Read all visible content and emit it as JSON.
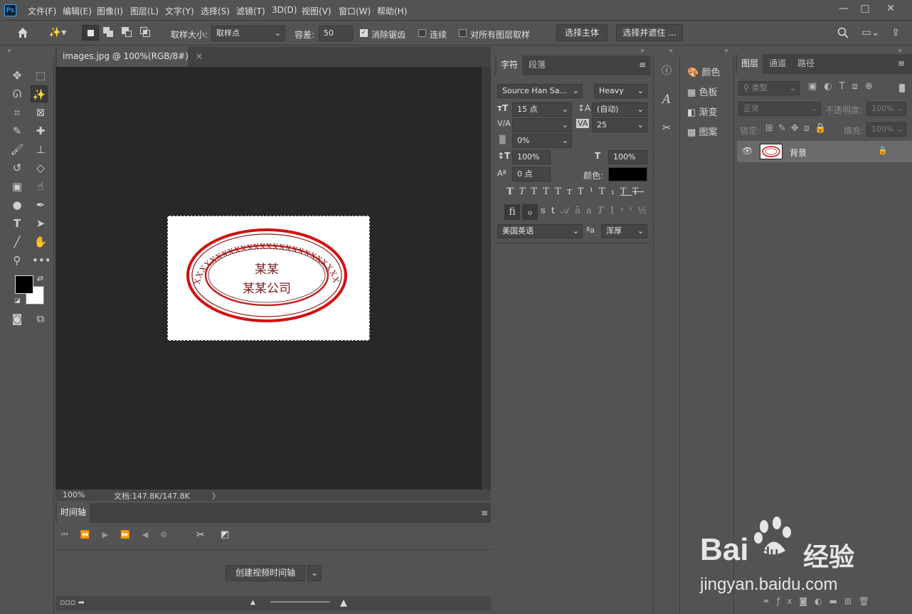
{
  "app": {
    "logo": "Ps"
  },
  "menu": [
    "文件(F)",
    "编辑(E)",
    "图像(I)",
    "图层(L)",
    "文字(Y)",
    "选择(S)",
    "滤镜(T)",
    "3D(D)",
    "视图(V)",
    "窗口(W)",
    "帮助(H)"
  ],
  "window_controls": {
    "minimize": "—",
    "restore": "□",
    "close": "✕"
  },
  "options": {
    "sample_size_label": "取样大小:",
    "sample_size_value": "取样点",
    "tolerance_label": "容差:",
    "tolerance_value": "50",
    "antialias_label": "消除锯齿",
    "contiguous_label": "连续",
    "all_layers_label": "对所有图层取样",
    "select_subject": "选择主体",
    "select_mask": "选择并遮住 ..."
  },
  "document": {
    "tab_title": "images.jpg @ 100%(RGB/8#)",
    "close": "×",
    "zoom": "100%",
    "doc_info": "文档:147.8K/147.8K",
    "arrow": "〉",
    "stamp_line1": "某某",
    "stamp_line2": "某某公司",
    "stamp_ring": "XXXXXXXXXXXXXXXXXXXXXXXXXXXX"
  },
  "timeline": {
    "title": "时间轴",
    "create_button": "创建视频时间轴"
  },
  "character": {
    "tab_char": "字符",
    "tab_para": "段落",
    "font_family": "Source Han Sa...",
    "font_style": "Heavy",
    "size": "15 点",
    "leading": "(自动)",
    "kerning": "",
    "tracking": "25",
    "scale_pct": "0%",
    "vscale": "100%",
    "hscale": "100%",
    "baseline": "0 点",
    "color_label": "颜色:",
    "language": "美国英语",
    "aa_label": "ªa",
    "aa_value": "浑厚",
    "color": "#000000"
  },
  "mini_panel": {
    "items": [
      "颜色",
      "色板",
      "渐变",
      "图案"
    ]
  },
  "layers": {
    "tab_layers": "图层",
    "tab_channels": "通道",
    "tab_paths": "路径",
    "filter_label": "类型",
    "blend": "正常",
    "opacity_label": "不透明度:",
    "opacity": "100%",
    "lock_label": "锁定:",
    "fill_label": "填充:",
    "fill": "100%",
    "layer_name": "背景"
  },
  "watermark": {
    "brand": "Bai",
    "brand2": "du",
    "product": "经验",
    "url": "jingyan.baidu.com"
  }
}
